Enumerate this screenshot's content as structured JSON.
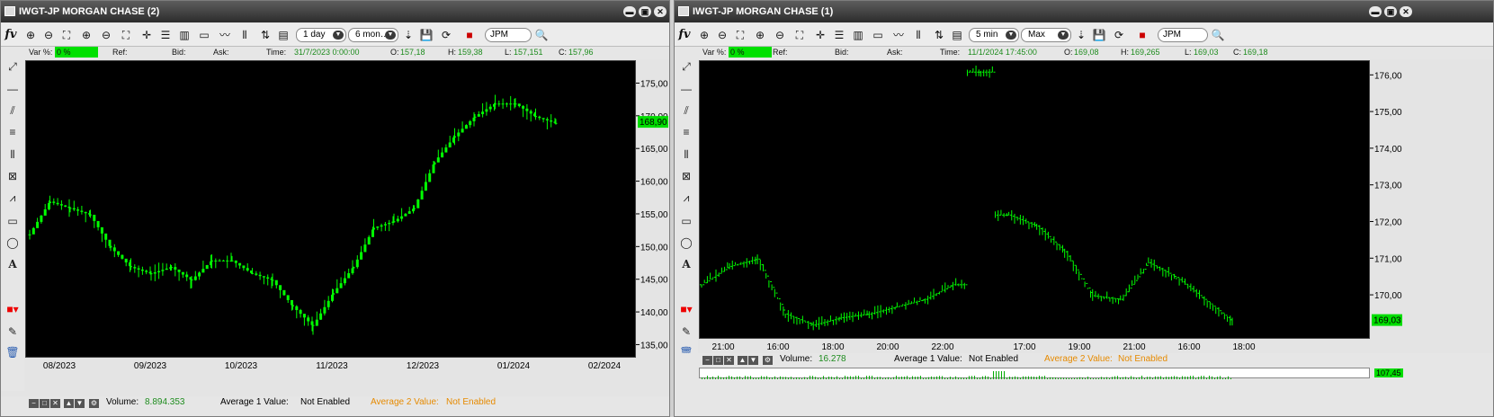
{
  "windows": [
    {
      "title": "IWGT-JP MORGAN CHASE (2)",
      "toolbar": {
        "fv_label": "fv",
        "period": "1 day",
        "range": "6 mon…",
        "symbol": "JPM"
      },
      "info": {
        "var_label": "Var %:",
        "var_value": "0 %",
        "ref_label": "Ref:",
        "bid_label": "Bid:",
        "ask_label": "Ask:",
        "time_label": "Time:",
        "time_value": "31/7/2023 0:00:00",
        "o_label": "O:",
        "o_value": "157,18",
        "h_label": "H:",
        "h_value": "159,38",
        "l_label": "L:",
        "l_value": "157,151",
        "c_label": "C:",
        "c_value": "157,96"
      },
      "bottom": {
        "volume_label": "Volume:",
        "volume_value": "8.894.353",
        "avg1_label": "Average 1 Value:",
        "avg1_value": "Not Enabled",
        "avg2_label": "Average 2 Value:",
        "avg2_value": "Not Enabled"
      },
      "last_price_label": "168,90"
    },
    {
      "title": "IWGT-JP MORGAN CHASE (1)",
      "toolbar": {
        "fv_label": "fv",
        "period": "5 min",
        "range": "Max",
        "symbol": "JPM"
      },
      "info": {
        "var_label": "Var %:",
        "var_value": "0 %",
        "ref_label": "Ref:",
        "bid_label": "Bid:",
        "ask_label": "Ask:",
        "time_label": "Time:",
        "time_value": "11/1/2024 17:45:00",
        "o_label": "O:",
        "o_value": "169,08",
        "h_label": "H:",
        "h_value": "169,265",
        "l_label": "L:",
        "l_value": "169,03",
        "c_label": "C:",
        "c_value": "169,18"
      },
      "bottom": {
        "volume_label": "Volume:",
        "volume_value": "16.278",
        "avg1_label": "Average 1 Value:",
        "avg1_value": "Not Enabled",
        "avg2_label": "Average 2 Value:",
        "avg2_value": "Not Enabled"
      },
      "last_price_label": "169,03",
      "volume_scale_label": "107,45"
    }
  ],
  "colors": {
    "price_line": "#00ff00",
    "background": "#000000",
    "last_price_box": "#00dd00"
  },
  "icons": [
    "fv-logo-icon",
    "zoom-in-icon",
    "zoom-out-icon",
    "zoom-fit-icon",
    "zoom-area-icon",
    "zoom-reset-icon",
    "zoom-full-icon",
    "crosshair-icon",
    "list-icon",
    "bars-icon",
    "frame-icon",
    "line-icon",
    "candles-icon",
    "ohlc-icon",
    "properties-icon",
    "save-icon",
    "floppy-icon",
    "refresh-icon",
    "color-icon",
    "search-icon"
  ],
  "chart_data": [
    {
      "type": "candlestick",
      "ylim": [
        133,
        178.5
      ],
      "yticks": [
        "135,00",
        "140,00",
        "145,00",
        "150,00",
        "155,00",
        "160,00",
        "165,00",
        "170,00",
        "175,00"
      ],
      "xticks": [
        "08/2023",
        "09/2023",
        "10/2023",
        "11/2023",
        "12/2023",
        "01/2024",
        "02/2024"
      ],
      "x": [
        "31/7",
        "7/8",
        "14/8",
        "21/8",
        "28/8",
        "4/9",
        "11/9",
        "18/9",
        "25/9",
        "2/10",
        "9/10",
        "16/10",
        "23/10",
        "27/10",
        "1/11",
        "8/11",
        "15/11",
        "22/11",
        "29/11",
        "6/12",
        "13/12",
        "20/12",
        "27/12",
        "3/1",
        "10/1",
        "11/1",
        "12/1"
      ],
      "values": [
        152,
        157,
        156,
        155,
        150,
        147,
        146,
        147,
        145,
        148,
        148,
        146,
        145,
        141,
        138,
        143,
        147,
        153,
        154,
        156,
        163,
        167,
        170,
        172,
        172,
        170,
        169
      ]
    },
    {
      "type": "line",
      "ylim": [
        168.8,
        176.4
      ],
      "yticks": [
        "170,00",
        "171,00",
        "172,00",
        "173,00",
        "174,00",
        "175,00",
        "176,00"
      ],
      "xticks": [
        "21:00",
        "16:00",
        "18:00",
        "20:00",
        "22:00",
        "17:00",
        "19:00",
        "21:00",
        "16:00",
        "18:00"
      ],
      "x": [
        "20:30",
        "21:30",
        "22:00",
        "16:00",
        "17:00",
        "18:00",
        "19:00",
        "20:00",
        "21:00",
        "22:00",
        "22:05",
        "16:30",
        "17:00",
        "17:30",
        "18:00",
        "19:00",
        "20:00",
        "21:00",
        "22:00",
        "15:45"
      ],
      "values": [
        170.3,
        170.8,
        171.0,
        169.5,
        169.2,
        169.4,
        169.5,
        169.7,
        169.9,
        170.3,
        176.1,
        172.2,
        171.9,
        171.2,
        170.0,
        169.9,
        170.9,
        170.5,
        169.9,
        169.3
      ]
    }
  ]
}
